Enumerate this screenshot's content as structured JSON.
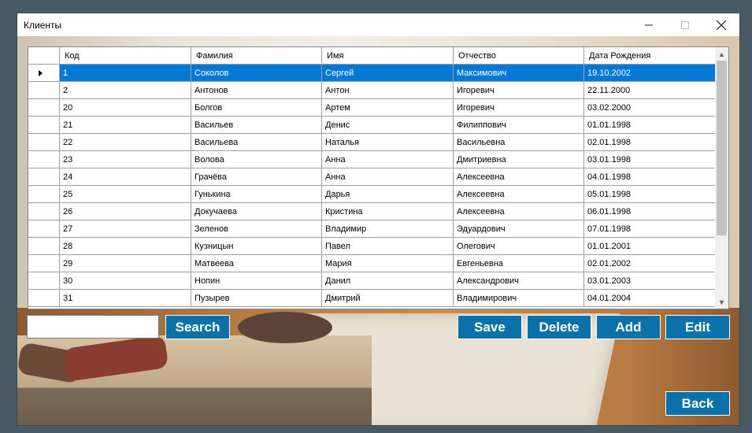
{
  "window": {
    "title": "Клиенты",
    "minimize_label": "—",
    "maximize_label": "☐",
    "close_label": "✕"
  },
  "grid": {
    "columns": [
      "Код",
      "Фамилия",
      "Имя",
      "Отчество",
      "Дата Рождения"
    ],
    "selected_row": 0,
    "rows": [
      [
        "1",
        "Соколов",
        "Сергей",
        "Максимович",
        "19.10.2002"
      ],
      [
        "2",
        "Антонов",
        "Антон",
        "Игоревич",
        "22.11.2000"
      ],
      [
        "20",
        "Болгов",
        "Артем",
        "Игоревич",
        "03.02.2000"
      ],
      [
        "21",
        "Васильев",
        "Денис",
        "Филиппович",
        "01.01.1998"
      ],
      [
        "22",
        "Васильева",
        "Наталья",
        "Васильевна",
        "02.01.1998"
      ],
      [
        "23",
        "Волова",
        "Анна",
        "Дмитриевна",
        "03.01.1998"
      ],
      [
        "24",
        "Грачёва",
        "Анна",
        "Алексеевна",
        "04.01.1998"
      ],
      [
        "25",
        "Гунькина",
        "Дарья",
        "Алексеевна",
        "05.01.1998"
      ],
      [
        "26",
        "Докучаева",
        "Кристина",
        "Алексеевна",
        "06.01.1998"
      ],
      [
        "27",
        "Зеленов",
        "Владимир",
        "Эдуардович",
        "07.01.1998"
      ],
      [
        "28",
        "Кузницын",
        "Павел",
        "Олегович",
        "01.01.2001"
      ],
      [
        "29",
        "Матвеева",
        "Мария",
        "Евгеньевна",
        "02.01.2002"
      ],
      [
        "30",
        "Нопин",
        "Данил",
        "Александрович",
        "03.01.2003"
      ],
      [
        "31",
        "Пузырев",
        "Дмитрий",
        "Владимирович",
        "04.01.2004"
      ]
    ]
  },
  "search": {
    "value": "",
    "button_label": "Search"
  },
  "actions": {
    "save_label": "Save",
    "delete_label": "Delete",
    "add_label": "Add",
    "edit_label": "Edit",
    "back_label": "Back"
  },
  "colors": {
    "button_bg": "#0a72a8",
    "selection": "#0078d7"
  }
}
